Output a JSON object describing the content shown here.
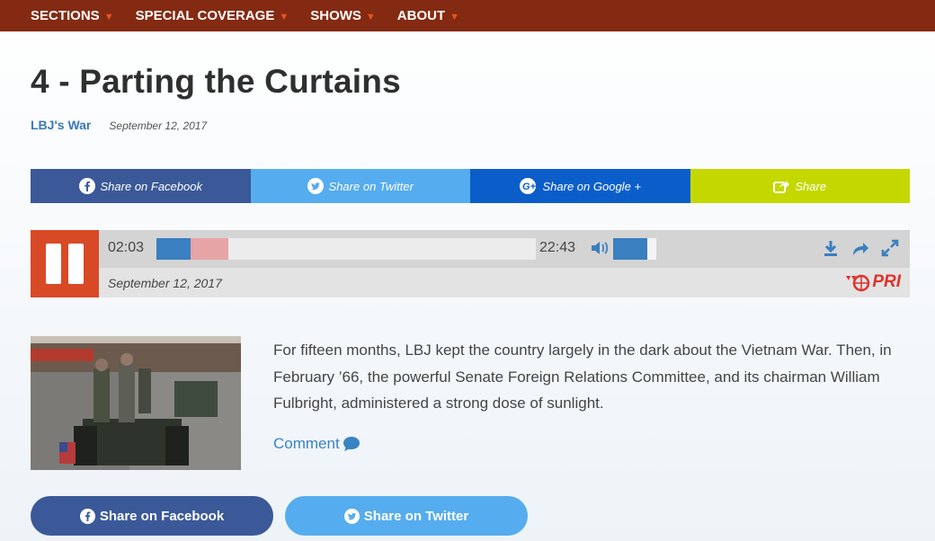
{
  "nav": {
    "items": [
      {
        "label": "SECTIONS"
      },
      {
        "label": "SPECIAL COVERAGE"
      },
      {
        "label": "SHOWS"
      },
      {
        "label": "ABOUT"
      }
    ],
    "caret": "▼"
  },
  "article": {
    "title": "4 - Parting the Curtains",
    "series": "LBJ's War",
    "date": "September 12, 2017"
  },
  "share_bar": {
    "facebook": {
      "label": "Share on Facebook",
      "color": "#3b5998"
    },
    "twitter": {
      "label": "Share on Twitter",
      "color": "#55acee"
    },
    "google": {
      "label": "Share on Google +",
      "color": "#0b5ec9"
    },
    "share": {
      "label": "Share",
      "color": "#c4d800"
    }
  },
  "player": {
    "current_time": "02:03",
    "duration": "22:43",
    "played_fraction": 0.09,
    "buffered_fraction": 0.19,
    "volume_fraction": 0.8,
    "date": "September 12, 2017",
    "logo_text": "PRI",
    "accent": "#d84a26"
  },
  "description": "For fifteen months, LBJ kept the country largely in the dark about the Vietnam War. Then, in February ’66, the powerful Senate Foreign Relations Committee, and its chairman William Fulbright, administered a strong dose of sunlight.",
  "comment_label": "Comment",
  "bottom_share": {
    "facebook": {
      "label": "Share on Facebook",
      "color": "#3b5998"
    },
    "twitter": {
      "label": "Share on Twitter",
      "color": "#55acee"
    }
  }
}
